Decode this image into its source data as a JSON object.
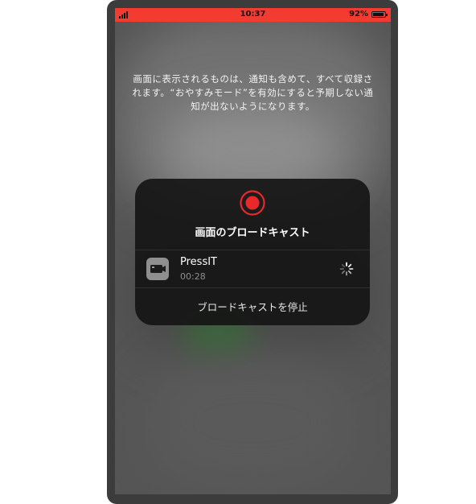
{
  "status_bar": {
    "time": "10:37",
    "battery": "92%",
    "color": "#f43b32"
  },
  "info_text": "画面に表示されるものは、通知も含めて、すべて収録されます。“おやすみモード”を有効にすると予期しない通知が出ないようになります。",
  "broadcast_card": {
    "title": "画面のブロードキャスト",
    "record_icon": "record-icon",
    "app": {
      "name": "PressIT",
      "elapsed": "00:28",
      "icon": "pressit-app-icon"
    },
    "spinner_icon": "loading-spinner-icon",
    "stop_label": "ブロードキャストを停止"
  }
}
